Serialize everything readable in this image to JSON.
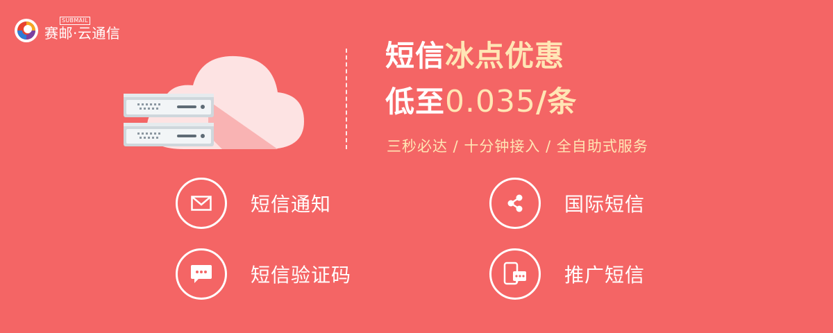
{
  "brand": {
    "sub": "SUBMAIL",
    "name": "赛邮·云通信"
  },
  "headline": {
    "part1": "短信",
    "part2": "冰点优惠"
  },
  "price": {
    "prefix": "低至",
    "amount": "0.035",
    "unit": "/条"
  },
  "tagline": "三秒必达 / 十分钟接入 / 全自助式服务",
  "features": [
    {
      "label": "短信通知",
      "icon": "envelope-icon"
    },
    {
      "label": "国际短信",
      "icon": "share-icon"
    },
    {
      "label": "短信验证码",
      "icon": "chat-bubble-icon"
    },
    {
      "label": "推广短信",
      "icon": "phone-message-icon"
    }
  ],
  "colors": {
    "background": "#f46565",
    "highlight": "#ffe6b5",
    "text": "#ffffff"
  }
}
